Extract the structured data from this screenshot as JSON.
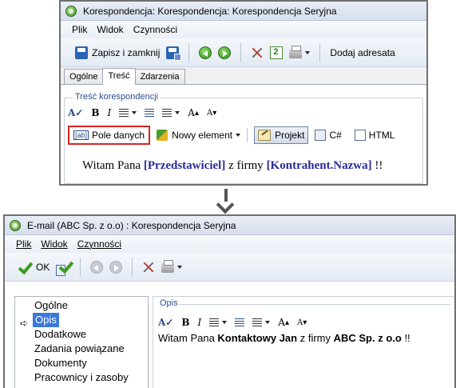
{
  "top_window": {
    "title": "Korespondencja: Korespondencja: Korespondencja Seryjna",
    "menu": [
      "Plik",
      "Widok",
      "Czynności"
    ],
    "toolbar": {
      "save_close": "Zapisz i zamknij",
      "add_recipient": "Dodaj adresata"
    },
    "tabs": [
      {
        "label": "Ogólne",
        "active": false
      },
      {
        "label": "Treść",
        "active": true
      },
      {
        "label": "Zdarzenia",
        "active": false
      }
    ],
    "group_title": "Treść korespondencji",
    "format_bar": {
      "bold": "B",
      "italic": "I",
      "grow_font": "A",
      "shrink_font": "A"
    },
    "insert_bar": {
      "data_field": "Pole danych",
      "new_element": "Nowy element",
      "project": "Projekt",
      "csharp": "C#",
      "html": "HTML"
    },
    "content": {
      "before": "Witam Pana ",
      "tag1": "[Przedstawiciel]",
      "middle": " z firmy ",
      "tag2": "[Kontrahent.Nazwa]",
      "after": " !!"
    }
  },
  "bottom_window": {
    "title": "E-mail (ABC Sp. z o.o) : Korespondencja Seryjna",
    "menu": [
      "Plik",
      "Widok",
      "Czynności"
    ],
    "toolbar": {
      "ok": "OK"
    },
    "nav_items": [
      {
        "label": "Ogólne",
        "selected": false
      },
      {
        "label": "Opis",
        "selected": true
      },
      {
        "label": "Dodatkowe",
        "selected": false
      },
      {
        "label": "Zadania powiązane",
        "selected": false
      },
      {
        "label": "Dokumenty",
        "selected": false
      },
      {
        "label": "Pracownicy i zasoby",
        "selected": false
      }
    ],
    "opis_title": "Opis",
    "format_bar": {
      "bold": "B",
      "italic": "I",
      "grow_font": "A",
      "shrink_font": "A"
    },
    "content": {
      "before": "Witam Pana ",
      "name": "Kontaktowy Jan",
      "middle": " z firmy ",
      "company": "ABC Sp. z o.o",
      "after": " !!"
    }
  },
  "colors": {
    "highlight_border": "#d42424",
    "selection": "#3b78d8",
    "tag_text": "#2a2a9a",
    "group_title": "#2a4d8f"
  }
}
